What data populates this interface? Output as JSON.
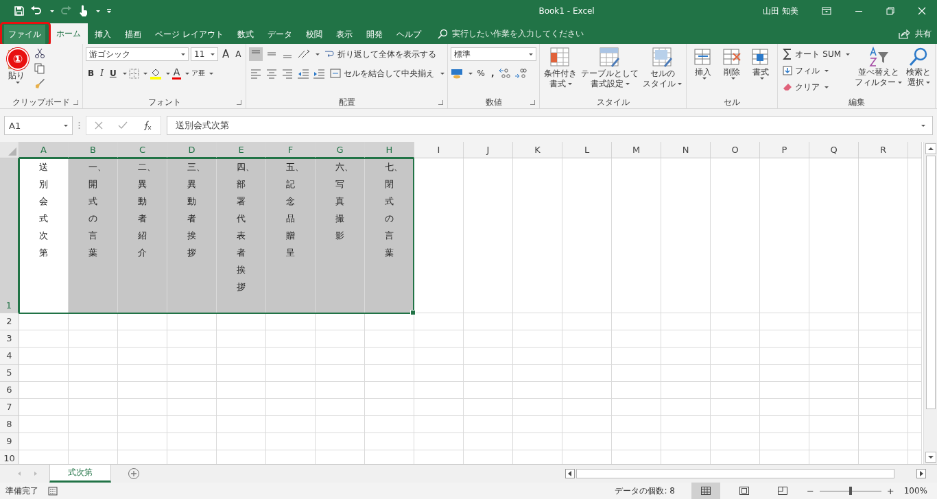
{
  "window": {
    "title": "Book1  -  Excel",
    "user": "山田 知美"
  },
  "ribbon_tabs": [
    {
      "label": "ファイル",
      "selected": false
    },
    {
      "label": "ホーム",
      "selected": true
    },
    {
      "label": "挿入",
      "selected": false
    },
    {
      "label": "描画",
      "selected": false
    },
    {
      "label": "ページ レイアウト",
      "selected": false
    },
    {
      "label": "数式",
      "selected": false
    },
    {
      "label": "データ",
      "selected": false
    },
    {
      "label": "校閲",
      "selected": false
    },
    {
      "label": "表示",
      "selected": false
    },
    {
      "label": "開発",
      "selected": false
    },
    {
      "label": "ヘルプ",
      "selected": false
    }
  ],
  "tell_me": {
    "placeholder": "実行したい作業を入力してください"
  },
  "share": "共有",
  "ribbon": {
    "clipboard": {
      "label": "クリップボード",
      "paste": "貼り"
    },
    "font": {
      "label": "フォント",
      "font_name": "游ゴシック",
      "font_size": "11",
      "grow": "A",
      "shrink": "A",
      "bold": "B",
      "italic": "I",
      "underline": "U",
      "font_color": "A",
      "phonetic": "ア亜"
    },
    "alignment": {
      "label": "配置",
      "wrap": "折り返して全体を表示する",
      "merge": "セルを結合して中央揃え"
    },
    "number": {
      "label": "数値",
      "format": "標準",
      "percent": "%",
      "comma": ","
    },
    "styles": {
      "label": "スタイル",
      "buttons": [
        [
          "条件付き",
          "書式"
        ],
        [
          "テーブルとして",
          "書式設定"
        ],
        [
          "セルの",
          "スタイル"
        ]
      ]
    },
    "cells": {
      "label": "セル",
      "buttons": [
        "挿入",
        "削除",
        "書式"
      ]
    },
    "editing": {
      "label": "編集",
      "autosum": "オート SUM",
      "fill": "フィル",
      "clear": "クリア",
      "buttons": [
        [
          "並べ替えと",
          "フィルター"
        ],
        [
          "検索と",
          "選択"
        ]
      ]
    }
  },
  "callout": "①",
  "name_box": "A1",
  "formula": "送別会式次第",
  "columns": [
    {
      "label": "A",
      "selected": true
    },
    {
      "label": "B",
      "selected": true
    },
    {
      "label": "C",
      "selected": true
    },
    {
      "label": "D",
      "selected": true
    },
    {
      "label": "E",
      "selected": true
    },
    {
      "label": "F",
      "selected": true
    },
    {
      "label": "G",
      "selected": true
    },
    {
      "label": "H",
      "selected": true
    },
    {
      "label": "I",
      "selected": false
    },
    {
      "label": "J",
      "selected": false
    },
    {
      "label": "K",
      "selected": false
    },
    {
      "label": "L",
      "selected": false
    },
    {
      "label": "M",
      "selected": false
    },
    {
      "label": "N",
      "selected": false
    },
    {
      "label": "O",
      "selected": false
    },
    {
      "label": "P",
      "selected": false
    },
    {
      "label": "Q",
      "selected": false
    },
    {
      "label": "R",
      "selected": false
    }
  ],
  "rows": [
    {
      "label": "1",
      "selected": true
    },
    {
      "label": "2",
      "selected": false
    },
    {
      "label": "3",
      "selected": false
    },
    {
      "label": "4",
      "selected": false
    },
    {
      "label": "5",
      "selected": false
    },
    {
      "label": "6",
      "selected": false
    },
    {
      "label": "7",
      "selected": false
    },
    {
      "label": "8",
      "selected": false
    },
    {
      "label": "9",
      "selected": false
    },
    {
      "label": "10",
      "selected": false
    }
  ],
  "cells": [
    {
      "text": "送別会式次第",
      "selected": true,
      "active": true
    },
    {
      "text": "一、開式の言葉",
      "selected": true,
      "active": false
    },
    {
      "text": "二、異動者紹介",
      "selected": true,
      "active": false
    },
    {
      "text": "三、異動者挨拶",
      "selected": true,
      "active": false
    },
    {
      "text": "四、部署代表者挨拶",
      "selected": true,
      "active": false
    },
    {
      "text": "五、記念品贈呈",
      "selected": true,
      "active": false
    },
    {
      "text": "六、写真撮影",
      "selected": true,
      "active": false
    },
    {
      "text": "七、閉式の言葉",
      "selected": true,
      "active": false
    }
  ],
  "sheet_tabs": [
    {
      "label": "式次第",
      "selected": true
    }
  ],
  "status": {
    "ready": "準備完了",
    "count": "データの個数: 8",
    "minus": "−",
    "plus": "+",
    "zoom": "100%",
    "zoom_slider": {
      "level": 0.5
    }
  }
}
